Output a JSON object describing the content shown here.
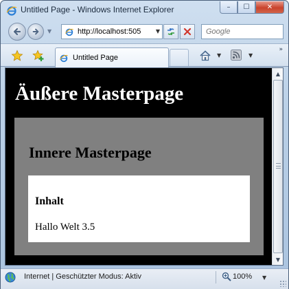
{
  "window": {
    "title": "Untitled Page - Windows Internet Explorer",
    "controls": {
      "minimize": "–",
      "maximize": "☐",
      "close": "✕"
    }
  },
  "navigation": {
    "back_icon": "back-arrow-icon",
    "forward_icon": "forward-arrow-icon",
    "address": "http://localhost:505",
    "search_placeholder": "Google"
  },
  "tabs": [
    {
      "label": "Untitled Page",
      "active": true
    }
  ],
  "page": {
    "outer_title": "Äußere Masterpage",
    "inner_title": "Innere Masterpage",
    "content_heading": "Inhalt",
    "content_text": "Hallo Welt 3.5"
  },
  "statusbar": {
    "status": "Internet | Geschützter Modus: Aktiv",
    "zoom": "100%"
  },
  "colors": {
    "outer_bg": "#000000",
    "inner_bg": "#808080",
    "content_bg": "#ffffff",
    "outer_text": "#ffffff"
  }
}
